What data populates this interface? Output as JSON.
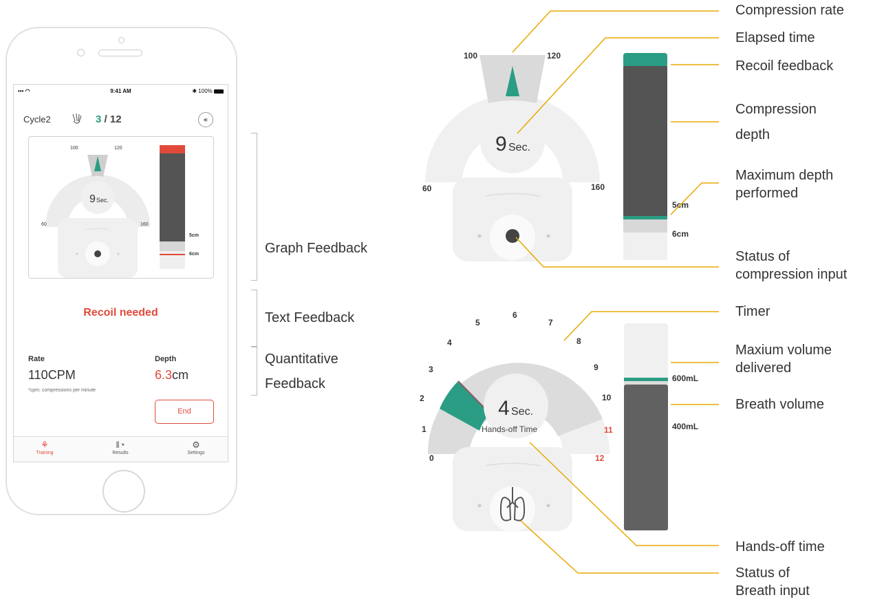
{
  "phone": {
    "status_signal": "••• ◠",
    "status_time": "9:41 AM",
    "status_battery": "✱ 100%",
    "cycle_label": "Cycle2",
    "count_current": "3",
    "count_total": " / 12",
    "mini": {
      "rate_left": "100",
      "rate_right": "120",
      "rate_min": "60",
      "rate_max": "160",
      "time_value": "9",
      "time_unit": "Sec.",
      "depth_5": "5cm",
      "depth_6": "6cm"
    },
    "text_feedback": "Recoil needed",
    "rate_label": "Rate",
    "rate_value": "110CPM",
    "rate_note": "*cpm: compressions per minute",
    "depth_label": "Depth",
    "depth_value": "6.3",
    "depth_unit": "cm",
    "end_label": "End",
    "tabs": [
      {
        "label": "Training",
        "icon": "training-icon"
      },
      {
        "label": "Results",
        "icon": "results-icon"
      },
      {
        "label": "Settings",
        "icon": "settings-icon"
      }
    ]
  },
  "brackets": {
    "graph": "Graph Feedback",
    "text": "Text Feedback",
    "quant_1": "Quantitative",
    "quant_2": "Feedback"
  },
  "compression_gauge": {
    "tick_100": "100",
    "tick_120": "120",
    "tick_60": "60",
    "tick_160": "160",
    "time_value": "9",
    "time_unit": "Sec.",
    "depth_5": "5cm",
    "depth_6": "6cm"
  },
  "breath_gauge": {
    "ticks": [
      "0",
      "1",
      "2",
      "3",
      "4",
      "5",
      "6",
      "7",
      "8",
      "9",
      "10",
      "11",
      "12"
    ],
    "time_value": "4",
    "time_unit": "Sec.",
    "time_caption": "Hands-off Time",
    "vol_600": "600mL",
    "vol_400": "400mL"
  },
  "callouts": {
    "compression_rate": "Compression rate",
    "elapsed_time": "Elapsed time",
    "recoil_feedback": "Recoil feedback",
    "compression_depth_1": "Compression",
    "compression_depth_2": "depth",
    "max_depth_1": "Maximum depth",
    "max_depth_2": "performed",
    "status_compression_1": "Status of",
    "status_compression_2": "compression input",
    "timer": "Timer",
    "max_volume_1": "Maxium volume",
    "max_volume_2": "delivered",
    "breath_volume": "Breath volume",
    "hands_off_time": "Hands-off time",
    "status_breath_1": "Status of",
    "status_breath_2": "Breath input"
  },
  "colors": {
    "teal": "#2a9d84",
    "red": "#e04a3a",
    "dark_bar": "#545454",
    "gauge_light": "#f0f0f0",
    "gauge_mid": "#dcdcdc",
    "callout_line": "#e8a800"
  }
}
